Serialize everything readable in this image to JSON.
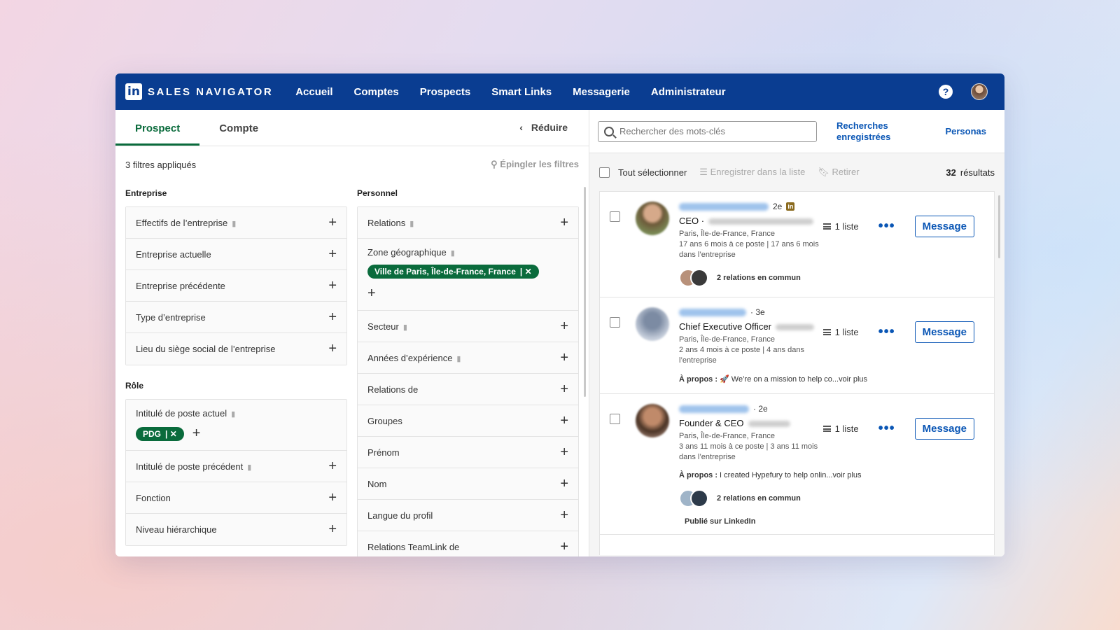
{
  "nav": {
    "brand": "SALES NAVIGATOR",
    "links": [
      "Accueil",
      "Comptes",
      "Prospects",
      "Smart Links",
      "Messagerie",
      "Administrateur"
    ],
    "help": "?"
  },
  "left": {
    "tabs": [
      "Prospect",
      "Compte"
    ],
    "reduce": "Réduire",
    "filters_applied": "3 filtres appliqués",
    "pin_filters": "Épingler les filtres",
    "entreprise_title": "Entreprise",
    "entreprise": [
      "Effectifs de l’entreprise",
      "Entreprise actuelle",
      "Entreprise précédente",
      "Type d’entreprise",
      "Lieu du siège social de l’entreprise"
    ],
    "role_title": "Rôle",
    "role_current": "Intitulé de poste actuel",
    "role_chip": "PDG",
    "role": [
      "Intitulé de poste précédent",
      "Fonction",
      "Niveau hiérarchique"
    ],
    "personnel_title": "Personnel",
    "relations": "Relations",
    "zone": "Zone géographique",
    "zone_chip": "Ville de Paris, Île-de-France, France",
    "personnel": [
      "Secteur",
      "Années d’expérience",
      "Relations de",
      "Groupes",
      "Prénom",
      "Nom",
      "Langue du profil",
      "Relations TeamLink de"
    ]
  },
  "right": {
    "search_placeholder": "Rechercher des mots-clés",
    "saved_line1": "Recherches",
    "saved_line2": "enregistrées",
    "personas": "Personas",
    "select_all": "Tout sélectionner",
    "save_to_list": "Enregistrer dans la liste",
    "remove": "Retirer",
    "results_count": "32",
    "results_label": "résultats",
    "list_label": "1 liste",
    "message": "Message",
    "dots": "•••",
    "cards": [
      {
        "degree": "2e",
        "title": "CEO ·",
        "location": "Paris, Île-de-France, France",
        "tenure1": "17 ans 6 mois à ce poste | 17 ans 6 mois",
        "tenure2": "dans l’entreprise",
        "mutual": "2 relations en commun"
      },
      {
        "degree": "· 3e",
        "title": "Chief Executive Officer",
        "location": "Paris, Île-de-France, France",
        "tenure1": "2 ans 4 mois à ce poste | 4 ans dans",
        "tenure2": "l’entreprise",
        "about_label": "À propos :",
        "about": " 🚀 We’re on a mission to help co...voir plus"
      },
      {
        "degree": "· 2e",
        "title": "Founder & CEO",
        "location": "Paris, Île-de-France, France",
        "tenure1": "3 ans 11 mois à ce poste | 3 ans 11 mois",
        "tenure2": "dans l’entreprise",
        "about_label": "À propos :",
        "about": " I created Hypefury to help onlin...voir plus",
        "mutual": "2 relations en commun",
        "posted": "Publié sur LinkedIn"
      }
    ]
  },
  "colors": {
    "nav": "#0a3d91",
    "accent_green": "#0a6b3c",
    "link_blue": "#0a56b5"
  }
}
